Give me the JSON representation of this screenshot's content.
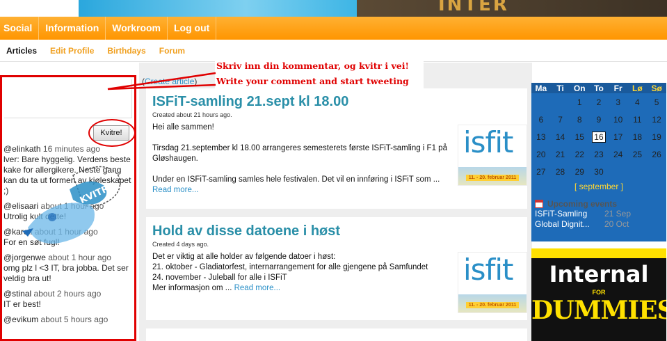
{
  "banner": {
    "text": "INTER"
  },
  "main_nav": {
    "items": [
      "Social",
      "Information",
      "Workroom",
      "Log out"
    ]
  },
  "sub_nav": {
    "items": [
      "Articles",
      "Edit Profile",
      "Birthdays",
      "Forum"
    ]
  },
  "twitter": {
    "button_label": "Kvitre!",
    "bird_label": "KVITRE",
    "tweets": [
      {
        "user": "@elinkath",
        "time": "16 minutes ago",
        "text": "lver: Bare hyggelig. Verdens beste kake for allergikere. Neste gang kan du ta ut formen av kjøleskapet ;)"
      },
      {
        "user": "@elisaari",
        "time": "about 1 hour ago",
        "text": "Utrolig kult dette!"
      },
      {
        "user": "@karolf",
        "time": "about 1 hour ago",
        "text": "For en søt fugl!"
      },
      {
        "user": "@jorgenwe",
        "time": "about 1 hour ago",
        "text": "omg plz l <3 IT, bra jobba. Det ser veldig bra ut!"
      },
      {
        "user": "@stinal",
        "time": "about 2 hours ago",
        "text": "IT er best!"
      },
      {
        "user": "@evikum",
        "time": "about 5 hours ago",
        "text": ""
      }
    ]
  },
  "annotation": {
    "line1": "Skriv inn din kommentar, og kvitr i vei!",
    "line2": "Write your comment and start tweeting"
  },
  "create_article": {
    "prefix": "(",
    "link": "Create article",
    "suffix": ")"
  },
  "articles": [
    {
      "title": "ISFiT-samling 21.sept kl 18.00",
      "meta": "Created about 21 hours ago.",
      "body": [
        "Hei alle sammen!",
        "",
        "Tirsdag 21.september kl 18.00 arrangeres semesterets første ISFiT-samling i F1 på Gløshaugen.",
        "",
        "Under en ISFiT-samling samles hele festivalen. Det vil en innføring i ISFiT som ..."
      ],
      "read_more": "Read more..."
    },
    {
      "title": "Hold av disse datoene i høst",
      "meta": "Created 4 days ago.",
      "body": [
        "Det er viktig at alle holder av følgende datoer i høst:",
        "21. oktober - Gladiatorfest, internarrangement for alle gjengene på Samfundet",
        "24. november - Juleball for alle i ISFiT",
        "Mer informasjon om ..."
      ],
      "read_more": "Read more..."
    }
  ],
  "isfit_logo": {
    "word": "isfit",
    "dates": "11. - 20. februar 2011"
  },
  "calendar": {
    "headers": [
      "Ma",
      "Ti",
      "On",
      "To",
      "Fr",
      "Lø",
      "Sø"
    ],
    "weeks": [
      [
        "",
        "",
        "1",
        "2",
        "3",
        "4",
        "5"
      ],
      [
        "6",
        "7",
        "8",
        "9",
        "10",
        "11",
        "12"
      ],
      [
        "13",
        "14",
        "15",
        "16",
        "17",
        "18",
        "19"
      ],
      [
        "20",
        "21",
        "22",
        "23",
        "24",
        "25",
        "26"
      ],
      [
        "27",
        "28",
        "29",
        "30",
        "",
        "",
        ""
      ]
    ],
    "today": "16",
    "month_label": "[ september ]",
    "upcoming_title": "Upcoming events",
    "events": [
      {
        "name": "ISFiT-Samling",
        "date": "21 Sep"
      },
      {
        "name": "Global Dignit...",
        "date": "20 Oct"
      }
    ]
  },
  "ad": {
    "line1": "Internal",
    "line2": "FOR",
    "line3": "DUMMIES"
  },
  "colors": {
    "orange": "#ff9500",
    "accent_blue": "#2a8fa8",
    "calendar_blue": "#1e6bb8",
    "annotation_red": "#e00000"
  }
}
